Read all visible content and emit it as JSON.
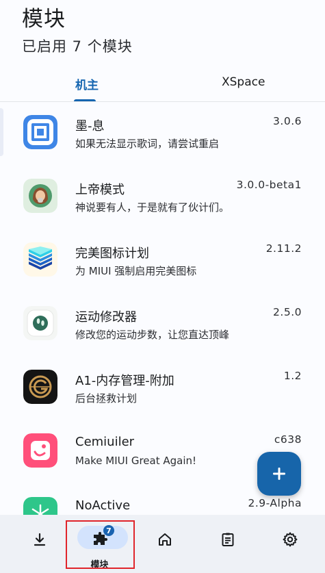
{
  "header": {
    "title": "模块",
    "subtitle": "已启用 7 个模块"
  },
  "tabs": [
    {
      "label": "机主",
      "active": true
    },
    {
      "label": "XSpace",
      "active": false
    }
  ],
  "modules": [
    {
      "name": "墨-息",
      "description": "如果无法显示歌词，请尝试重启",
      "version": "3.0.6",
      "icon": "lyric-icon"
    },
    {
      "name": "上帝模式",
      "description": "神说要有人，于是就有了伙计们。",
      "version": "3.0.0-beta1",
      "icon": "god-mode-icon"
    },
    {
      "name": "完美图标计划",
      "description": "为 MIUI 强制启用完美图标",
      "version": "2.11.2",
      "icon": "layers-icon"
    },
    {
      "name": "运动修改器",
      "description": "修改您的运动步数，让您直达顶峰",
      "version": "2.5.0",
      "icon": "steps-icon"
    },
    {
      "name": "A1-内存管理-附加",
      "description": "后台拯救计划",
      "version": "1.2",
      "icon": "memory-icon"
    },
    {
      "name": "Cemiuiler",
      "description": "Make MIUI Great Again!",
      "version": "c638",
      "icon": "cemiuiler-icon"
    },
    {
      "name": "NoActive",
      "description": "",
      "version": "2.9-Alpha",
      "icon": "snowflake-icon"
    }
  ],
  "fab": {
    "icon": "plus-icon"
  },
  "navbar": {
    "items": [
      {
        "icon": "download-icon",
        "label": ""
      },
      {
        "icon": "puzzle-icon",
        "label": "模块",
        "badge": "7",
        "active": true
      },
      {
        "icon": "home-icon",
        "label": ""
      },
      {
        "icon": "clipboard-icon",
        "label": ""
      },
      {
        "icon": "gear-icon",
        "label": ""
      }
    ]
  },
  "colors": {
    "accent": "#1565b0",
    "fab": "#1765aa",
    "navbar_bg": "#eef1f6",
    "highlight_box": "#e0242a"
  }
}
